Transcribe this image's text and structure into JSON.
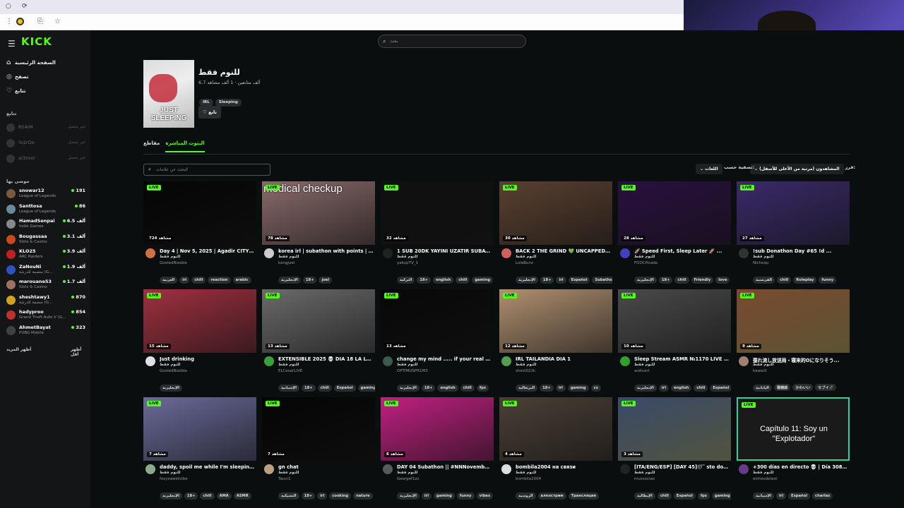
{
  "browser": {
    "tab_controls": [
      "○",
      "⟳"
    ],
    "address_icons": [
      "⋮",
      "⎘",
      "☆"
    ]
  },
  "sidebar": {
    "logo": "KICK",
    "nav": [
      {
        "label": "الصفحة الرئيسية",
        "icon": "home-icon",
        "glyph": "⌂"
      },
      {
        "label": "تصفح",
        "icon": "browse-icon",
        "glyph": "◎"
      },
      {
        "label": "تتابع",
        "icon": "heart-icon",
        "glyph": "♡"
      }
    ],
    "following_heading": "تتابع",
    "following": [
      {
        "name": "BSAIM",
        "status": "غير متصل"
      },
      {
        "name": "YujirOo",
        "status": "غير متصل"
      },
      {
        "name": "al3zool",
        "status": "غير متصل"
      }
    ],
    "recommended_heading": "موصى بها",
    "recommended": [
      {
        "name": "snowar12",
        "category": "League of Legends",
        "viewers": "191",
        "color": "#7a5a3a"
      },
      {
        "name": "Santtosa",
        "category": "League of Legends",
        "viewers": "86",
        "color": "#6a8a9a"
      },
      {
        "name": "HamadSenpai",
        "category": "Indie Games",
        "viewers": "6.5 ألف",
        "color": "#888"
      },
      {
        "name": "Bougassaa",
        "category": "Slots & Casino",
        "viewers": "3.1 ألف",
        "color": "#c84a1a"
      },
      {
        "name": "KLO25",
        "category": "ARC Raiders",
        "viewers": "3.9 ألف",
        "color": "#c02020"
      },
      {
        "name": "ZaNouNi",
        "category": "منصمة للدرشة (G...",
        "viewers": "1.9 ألف",
        "color": "#3050c0"
      },
      {
        "name": "marouane53",
        "category": "Slots & Casino",
        "viewers": "1.7 ألف",
        "color": "#a07060"
      },
      {
        "name": "sheshtawy1",
        "category": "منصمة للدرشة (G...",
        "viewers": "870",
        "color": "#d4a020"
      },
      {
        "name": "hadyproo",
        "category": "Grand Theft Auto V (G...",
        "viewers": "854",
        "color": "#c03030"
      },
      {
        "name": "AhmetBayat",
        "category": "PUBG Mobile",
        "viewers": "323",
        "color": "#404040"
      }
    ],
    "show_more": "أظهر المزيد",
    "show_less": "أظهر أقل"
  },
  "search": {
    "placeholder": "بحث"
  },
  "category": {
    "title": "للنوم فقط",
    "stats": "6.7 ألف متابعين · 1 ألف مشاهد",
    "image_text": "JUST SLEEPING",
    "tags": [
      "IRL",
      "Sleeping"
    ],
    "follow_label": "تابع"
  },
  "tabs": {
    "live": "البثوث المباشرة",
    "clips": "مقاطع"
  },
  "filters": {
    "tag_search_placeholder": "البحث عن علامات",
    "sort_label": "فرز حسب:",
    "sort_value": "المشاهدون (مرتبة من الأعلى للأسفل)",
    "filter_label": "تصفية حسب:",
    "filter_value": "اللغات"
  },
  "streams": [
    {
      "title": "Day 4 | Nov 5, 2025 | Agadir CITY ...",
      "category": "للنوم فقط",
      "user": "GostedNoobie",
      "viewers": "724 مشاهد",
      "tags": [
        "العربية",
        "irl",
        "chill",
        "reaction",
        "arabic"
      ],
      "bg": "#050505",
      "av": "#d07040"
    },
    {
      "title": "korea irl | subathon with points | !tts",
      "category": "للنوم فقط",
      "user": "kangjoel",
      "viewers": "78 مشاهد",
      "tags": [
        "الإنجليزية",
        "18+",
        "joel"
      ],
      "bg": "#8a6a6a",
      "av": "#ccc",
      "overlay": "medical checkup"
    },
    {
      "title": "1 SUB 20DK YAYINI UZATIR SUBATH...",
      "category": "للنوم فقط",
      "user": "yakupTV_1",
      "viewers": "32 مشاهد",
      "tags": [
        "التركية",
        "18+",
        "english",
        "chill",
        "gaming"
      ],
      "bg": "#101010",
      "av": "#222"
    },
    {
      "title": "BACK 2 THE GRIND 💚 UNCAPPED ...",
      "category": "للنوم فقط",
      "user": "LolaBunz",
      "viewers": "30 مشاهد",
      "tags": [
        "الإنجليزية",
        "18+",
        "irl",
        "Español",
        "Subathon"
      ],
      "bg": "#5a4030",
      "av": "#d06060"
    },
    {
      "title": "🚀 Speed First, Sleep Later 🚀 ...",
      "category": "للنوم فقط",
      "user": "FOOCHcade",
      "viewers": "28 مشاهد",
      "tags": [
        "الإنجليزية",
        "18+",
        "chill",
        "Friendly",
        "love"
      ],
      "bg": "#2a1040",
      "av": "#4040c0"
    },
    {
      "title": "!sub Donathon Day #65 !d ...",
      "category": "للنوم فقط",
      "user": "Nichoqu",
      "viewers": "27 مشاهد",
      "tags": [
        "الفرنسية",
        "chill",
        "Roleplay",
        "funny"
      ],
      "bg": "#3a2a6a",
      "av": "#333"
    },
    {
      "title": "Just drinking",
      "category": "للنوم فقط",
      "user": "GostedNoobie",
      "viewers": "15 مشاهد",
      "tags": [
        "الإنجليزية"
      ],
      "bg": "#a03040",
      "av": "#e0e0e0"
    },
    {
      "title": "EXTENSIBLE 2025 💀 DIA 18 LA LOC...",
      "category": "للنوم فقط",
      "user": "ELCesarLIVE",
      "viewers": "13 مشاهد",
      "tags": [
        "الإسبانية",
        "18+",
        "chill",
        "Español",
        "gaming"
      ],
      "bg": "#6a6a6a",
      "av": "#3aa040"
    },
    {
      "title": "change my mind ..... if your real com...",
      "category": "للنوم فقط",
      "user": "OPTIMUSPR1M3",
      "viewers": "13 مشاهد",
      "tags": [
        "الإنجليزية",
        "18+",
        "english",
        "chill",
        "fps"
      ],
      "bg": "#080808",
      "av": "#3a5a4a"
    },
    {
      "title": "IRL TAILANDIA DIA 1",
      "category": "للنوم فقط",
      "user": "shevi022k",
      "viewers": "12 مشاهد",
      "tags": [
        "البرتغالية",
        "18+",
        "irl",
        "gaming",
        "cs"
      ],
      "bg": "#b09070",
      "av": "#50a050"
    },
    {
      "title": "Sleep Stream ASMR №1170 LIVE 5.11...",
      "category": "للنوم فقط",
      "user": "wizhunt",
      "viewers": "10 مشاهد",
      "tags": [
        "الإنجليزية",
        "irl",
        "english",
        "chill",
        "Español"
      ],
      "bg": "#4a4a4a",
      "av": "#30a030"
    },
    {
      "title": "蚕れ流し放送局・寝来的Oになりそう...",
      "category": "للنوم فقط",
      "user": "kawai3",
      "viewers": "9 مشاهد",
      "tags": [
        "اليابانية",
        "寝雑談",
        "かわいい",
        "セブイ💣"
      ],
      "bg": "#7a4a30",
      "av": "#a08070"
    },
    {
      "title": "daddy, spoil me while I'm sleeping...",
      "category": "للنوم فقط",
      "user": "foxysweetvibe",
      "viewers": "7 مشاهد",
      "tags": [
        "الإنجليزية",
        "18+",
        "chill",
        "AMA",
        "ASMR"
      ],
      "bg": "#6a6a9a",
      "av": "#8aaa8a"
    },
    {
      "title": "gn chat",
      "category": "للنوم فقط",
      "user": "Tauvi1",
      "viewers": "7 مشاهد",
      "tags": [
        "التشيكية",
        "18+",
        "irl",
        "cooking",
        "nature"
      ],
      "bg": "#050505",
      "av": "#bba080"
    },
    {
      "title": "DAY 04 Subathon || #NNNovembert...",
      "category": "للنوم فقط",
      "user": "Georgef1zz",
      "viewers": "6 مشاهد",
      "tags": [
        "الإنجليزية",
        "irl",
        "gaming",
        "funny",
        "vibes"
      ],
      "bg": "#c02080",
      "av": "#5a5a5a"
    },
    {
      "title": "bombila2004 на связи",
      "category": "للنوم فقط",
      "user": "bombila2004",
      "viewers": "4 مشاهد",
      "tags": [
        "الروسية",
        "алкострим",
        "Трансляция"
      ],
      "bg": "#4a4036",
      "av": "#ddd"
    },
    {
      "title": "[ITA/ENG/ESP] [DAY 45]😴 sto dorm...",
      "category": "للنوم فقط",
      "user": "mussociao",
      "viewers": "3 مشاهد",
      "tags": [
        "الإيطالية",
        "chill",
        "Español",
        "fps",
        "gaming"
      ],
      "bg": "#3a4a6a",
      "av": "#222"
    },
    {
      "title": "+300 días en directo 💀 | Día 308/3...",
      "category": "للنوم فقط",
      "user": "elchesdelast",
      "viewers": "",
      "tags": [
        "الإسبانية",
        "irl",
        "Español",
        "charlas"
      ],
      "bg": "#1e3a3a",
      "av": "#6a3a8a",
      "overlay": "Capítulo 11: Soy un \"Explotador\""
    }
  ],
  "live_label": "LIVE"
}
